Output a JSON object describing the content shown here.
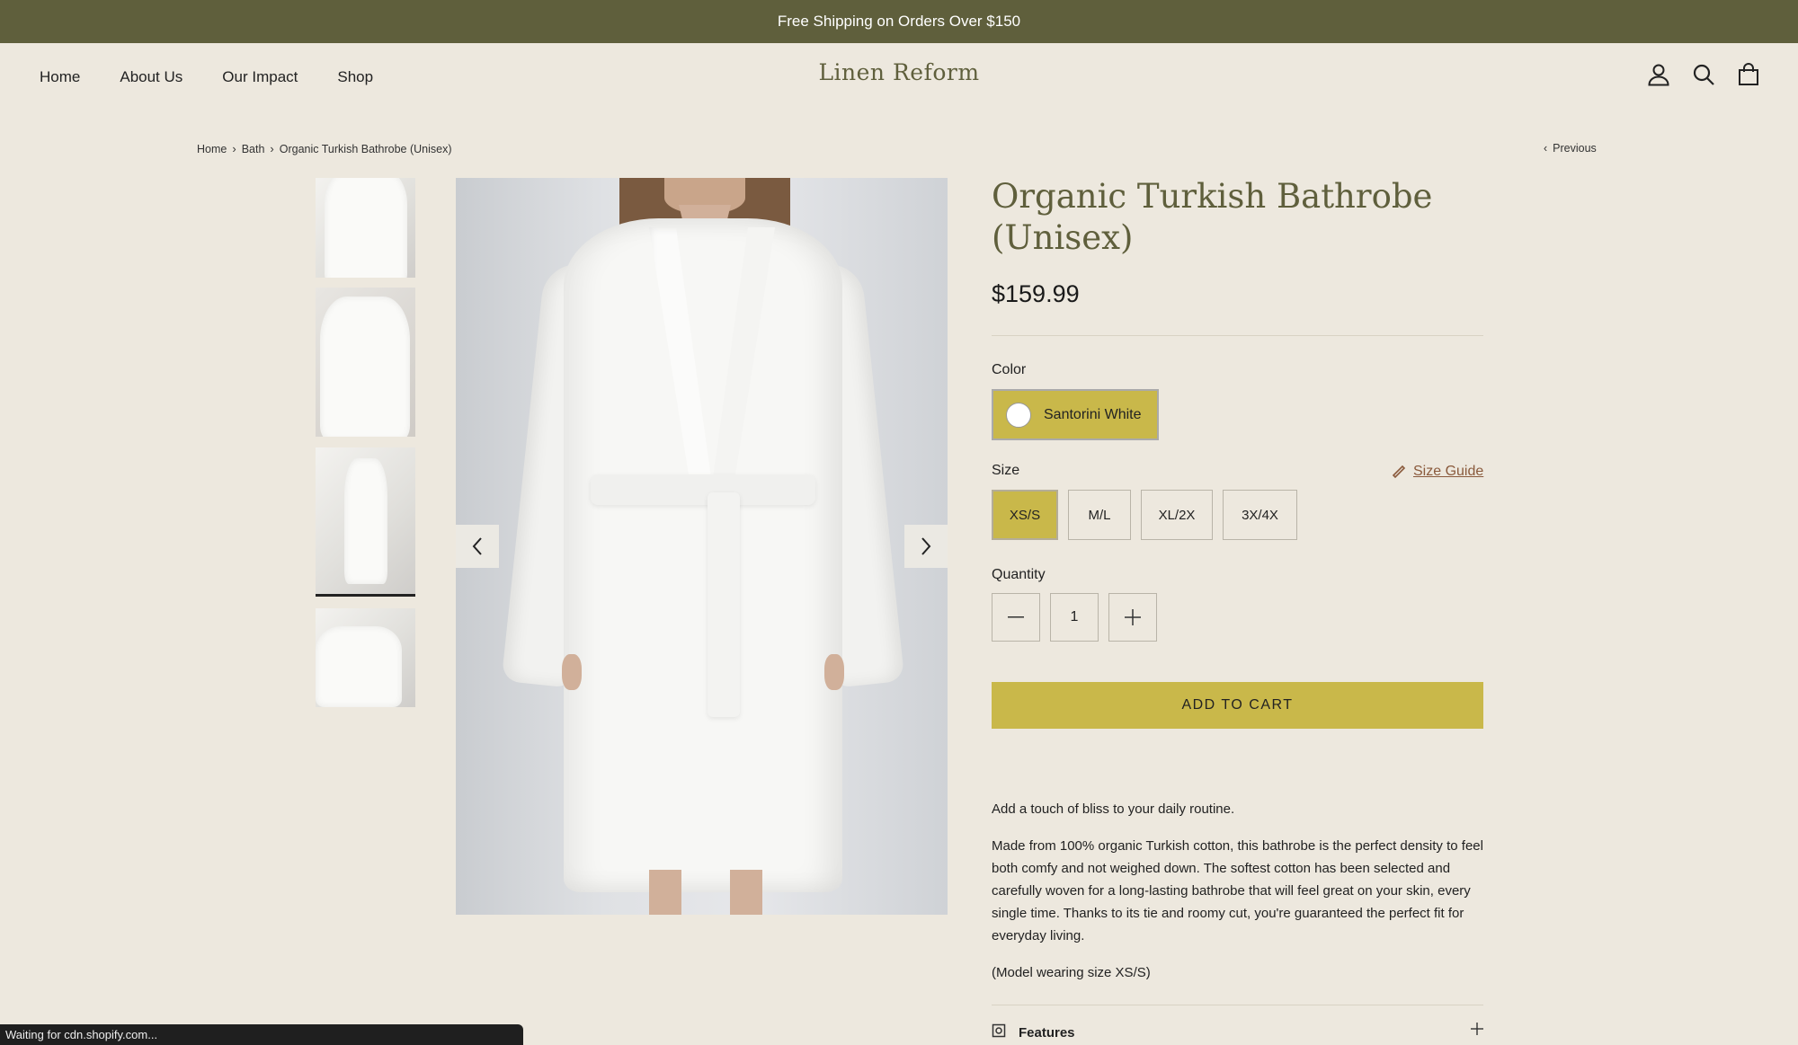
{
  "announcement": "Free Shipping on Orders Over $150",
  "nav": {
    "items": [
      "Home",
      "About Us",
      "Our Impact",
      "Shop"
    ],
    "logo": "Linen Reform",
    "icons": [
      "account-icon",
      "search-icon",
      "cart-icon"
    ]
  },
  "breadcrumb": {
    "items": [
      "Home",
      "Bath",
      "Organic Turkish Bathrobe (Unisex)"
    ],
    "previous": "Previous"
  },
  "product": {
    "title": "Organic Turkish Bathrobe (Unisex)",
    "price": "$159.99",
    "color_label": "Color",
    "color_value": "Santorini White",
    "size_label": "Size",
    "size_guide": "Size Guide",
    "sizes": [
      "XS/S",
      "M/L",
      "XL/2X",
      "3X/4X"
    ],
    "selected_size": "XS/S",
    "quantity_label": "Quantity",
    "quantity": "1",
    "add_to_cart": "ADD TO CART",
    "description": [
      "Add a touch of bliss to your daily routine.",
      "Made from 100% organic Turkish cotton, this bathrobe is the perfect density to feel both comfy and not weighed down. The softest cotton has been selected and carefully woven for a long-lasting bathrobe that will feel great on your skin, every single time. Thanks to its tie and roomy cut, you're guaranteed the perfect fit for everyday living.",
      "(Model wearing size XS/S)"
    ],
    "features_label": "Features"
  },
  "status_bar": "Waiting for cdn.shopify.com...",
  "colors": {
    "brand_olive": "#5f5f3c",
    "accent_yellow": "#c9b84a",
    "background": "#ede8de"
  }
}
